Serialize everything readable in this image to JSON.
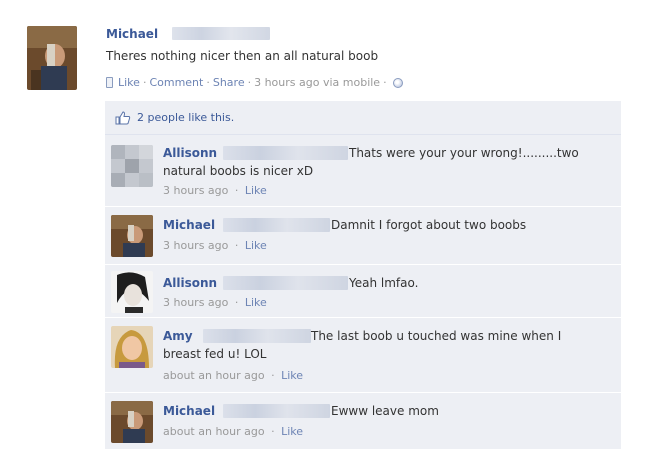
{
  "post": {
    "author": "Michael",
    "text": "Theres nothing nicer then an all natural boob",
    "like_link": "Like",
    "comment_link": "Comment",
    "share_link": "Share",
    "sep": "·",
    "time": "3 hours ago via mobile"
  },
  "likes": {
    "text": "2 people like this."
  },
  "comments": [
    {
      "name": "Allisonn",
      "text_line1": "Thats were your your wrong!.........two",
      "text_line2": "natural boobs is nicer xD",
      "time": "3 hours ago",
      "like": "Like"
    },
    {
      "name": "Michael",
      "text_line1": "Damnit I forgot about two boobs",
      "time": "3 hours ago",
      "like": "Like"
    },
    {
      "name": "Allisonn",
      "text_line1": "Yeah lmfao.",
      "time": "3 hours ago",
      "like": "Like"
    },
    {
      "name": "Amy",
      "text_line1": "The last boob u touched was mine when I",
      "text_line2": "breast fed u! LOL",
      "time": "about an hour ago",
      "like": "Like"
    },
    {
      "name": "Michael",
      "text_line1": "Ewww leave mom",
      "time": "about an hour ago",
      "like": "Like"
    }
  ],
  "colors": {
    "link": "#3b5998",
    "meta_link": "#6d84b4",
    "comment_bg": "#edeff4"
  }
}
